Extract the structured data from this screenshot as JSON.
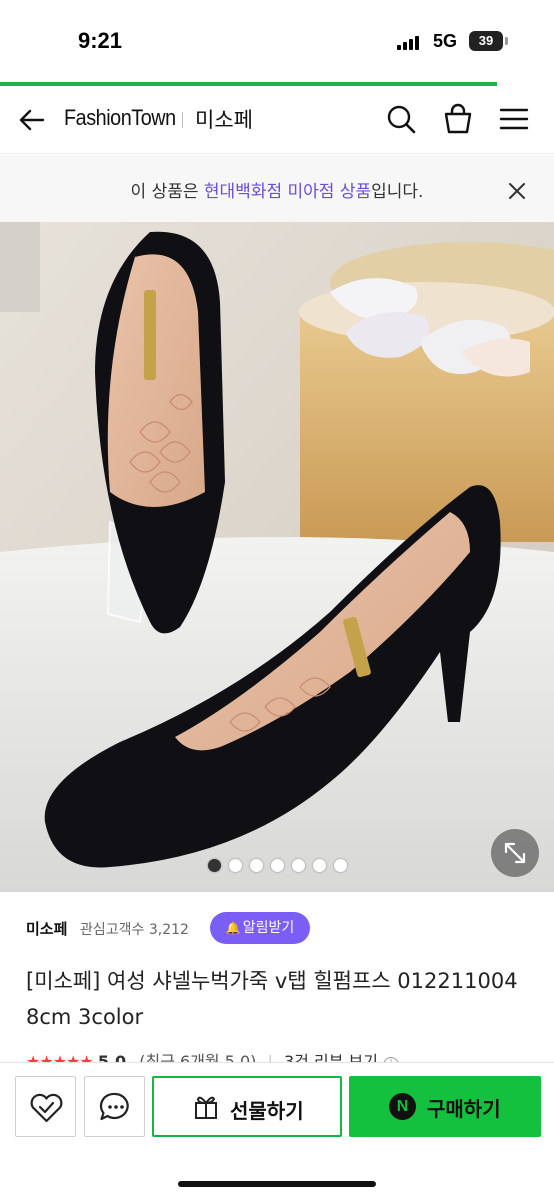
{
  "status_bar": {
    "time": "9:21",
    "network": "5G",
    "battery": "39"
  },
  "header": {
    "brand": "FashionTown",
    "shop_name": "미소페"
  },
  "notice": {
    "prefix": "이 상품은 ",
    "highlight": "현대백화점 미아점 상품",
    "suffix": "입니다."
  },
  "gallery": {
    "image_count": 7,
    "active_index": 0
  },
  "seller": {
    "name": "미소페",
    "followers": "관심고객수 3,212",
    "alarm_label": "알림받기"
  },
  "product": {
    "title": "[미소페] 여성 샤넬누벅가죽 v탭 힐펌프스 012211004 8cm 3color",
    "rating_stars": "★★★★★",
    "rating_value": "5.0",
    "rating_period": "(최근 6개월 5.0)",
    "review_link": "3건 리뷰 보기"
  },
  "bottom_bar": {
    "gift_label": "선물하기",
    "buy_label": "구매하기",
    "npay_badge": "N"
  },
  "colors": {
    "accent_green": "#13c13f",
    "accent_purple": "#7b5ef5",
    "highlight_purple": "#6b4fd8",
    "star_red": "#ff3b3b"
  }
}
